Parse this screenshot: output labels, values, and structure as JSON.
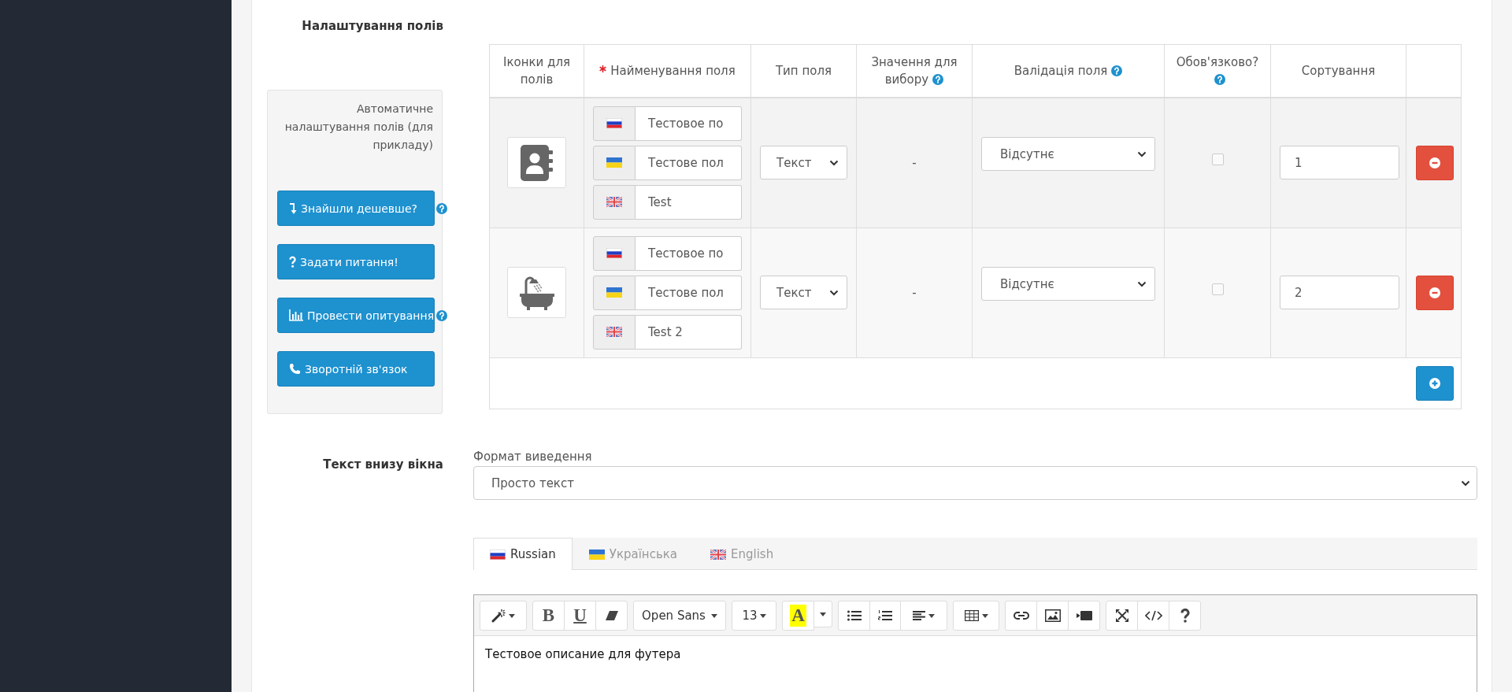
{
  "field_settings": {
    "label": "Налаштування полів",
    "auto_setup": {
      "caption": "Автоматичне налаштування полів (для прикладу)",
      "buttons": [
        {
          "label": "Знайшли дешевше?",
          "help": true
        },
        {
          "label": "Задати питання!",
          "help": false
        },
        {
          "label": "Провести опитування",
          "help": true
        },
        {
          "label": "Зворотній зв'язок",
          "help": false
        }
      ]
    },
    "table": {
      "columns": [
        {
          "label": "Іконки для полів",
          "required": false,
          "help": false
        },
        {
          "label": "Найменування поля",
          "required": true,
          "help": false
        },
        {
          "label": "Тип поля",
          "required": false,
          "help": false
        },
        {
          "label": "Значення для вибору",
          "required": false,
          "help": true
        },
        {
          "label": "Валідація поля",
          "required": false,
          "help": true
        },
        {
          "label": "Обов'язково?",
          "required": false,
          "help": true
        },
        {
          "label": "Сортування",
          "required": false,
          "help": false
        }
      ],
      "rows": [
        {
          "names": [
            "Тестовое по",
            "Тестове пол",
            "Test"
          ],
          "type": "Текст",
          "choices": "-",
          "validation": "Відсутнє",
          "mandatory": false,
          "sort": "1"
        },
        {
          "names": [
            "Тестовое по",
            "Тестове пол",
            "Test 2"
          ],
          "type": "Текст",
          "choices": "-",
          "validation": "Відсутнє",
          "mandatory": false,
          "sort": "2"
        }
      ]
    }
  },
  "footer_text": {
    "label": "Текст внизу вікна",
    "format": {
      "label": "Формат виведення",
      "value": "Просто текст"
    },
    "tabs": [
      {
        "label": "Russian",
        "selected": true
      },
      {
        "label": "Українська",
        "selected": false
      },
      {
        "label": "English",
        "selected": false
      }
    ],
    "toolbar": {
      "bold": "B",
      "underline": "U",
      "font": "Open Sans",
      "font_size": "13",
      "highlight": "A"
    },
    "content": "Тестовое описание для футера"
  }
}
